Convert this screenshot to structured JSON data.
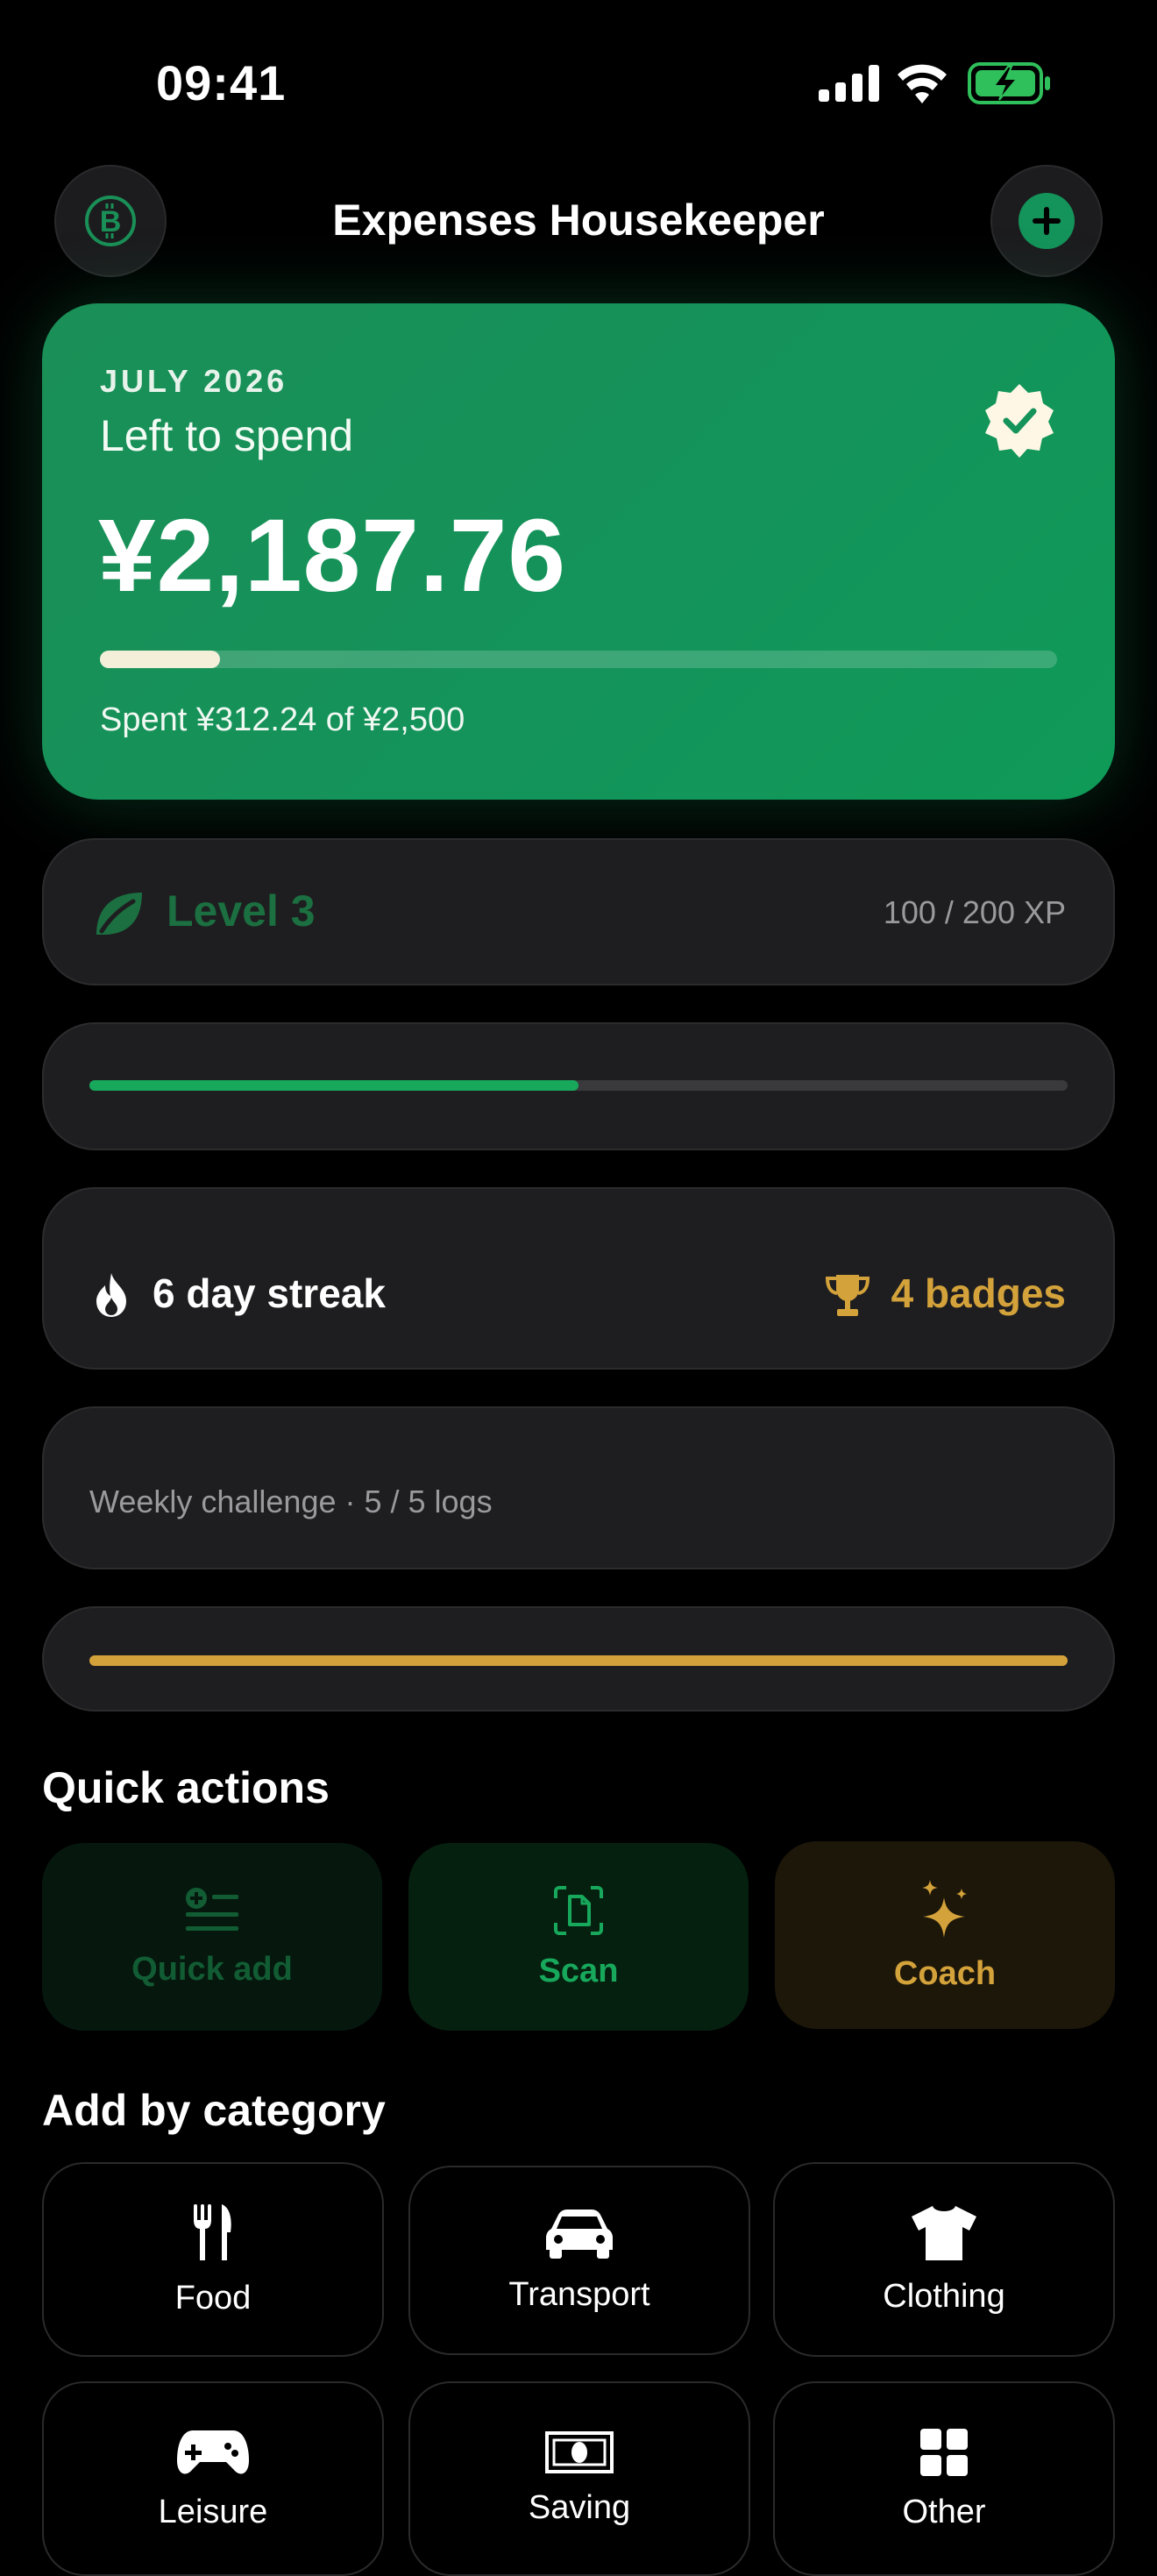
{
  "status": {
    "time": "09:41"
  },
  "header": {
    "title": "Expenses Housekeeper",
    "left_icon": "bitcoin-circle-icon",
    "right_icon": "plus-icon"
  },
  "budget": {
    "month": "JULY 2026",
    "label": "Left to spend",
    "amount": "¥2,187.76",
    "spent_text": "Spent ¥312.24 of ¥2,500",
    "spent_fraction": 0.125,
    "badge_icon": "verified-badge-icon"
  },
  "level": {
    "label": "Level 3",
    "xp": "100 / 200 XP",
    "progress_fraction": 0.5
  },
  "streak": {
    "label": "6 day streak",
    "badges": "4 badges"
  },
  "challenge": {
    "label": "Weekly challenge · 5 / 5 logs",
    "progress_fraction": 1.0
  },
  "quick_actions": {
    "title": "Quick actions",
    "items": [
      {
        "label": "Quick add",
        "icon": "quick-add-icon"
      },
      {
        "label": "Scan",
        "icon": "scan-icon"
      },
      {
        "label": "Coach",
        "icon": "sparkles-icon"
      }
    ]
  },
  "categories": {
    "title": "Add by category",
    "items": [
      {
        "label": "Food",
        "icon": "fork-knife-icon"
      },
      {
        "label": "Transport",
        "icon": "car-icon"
      },
      {
        "label": "Clothing",
        "icon": "tshirt-icon"
      },
      {
        "label": "Leisure",
        "icon": "gamepad-icon"
      },
      {
        "label": "Saving",
        "icon": "banknote-icon"
      },
      {
        "label": "Other",
        "icon": "grid-icon"
      }
    ]
  },
  "colors": {
    "accent_green": "#14935a",
    "gold": "#d4a23a",
    "card_bg": "#1e1e20"
  }
}
